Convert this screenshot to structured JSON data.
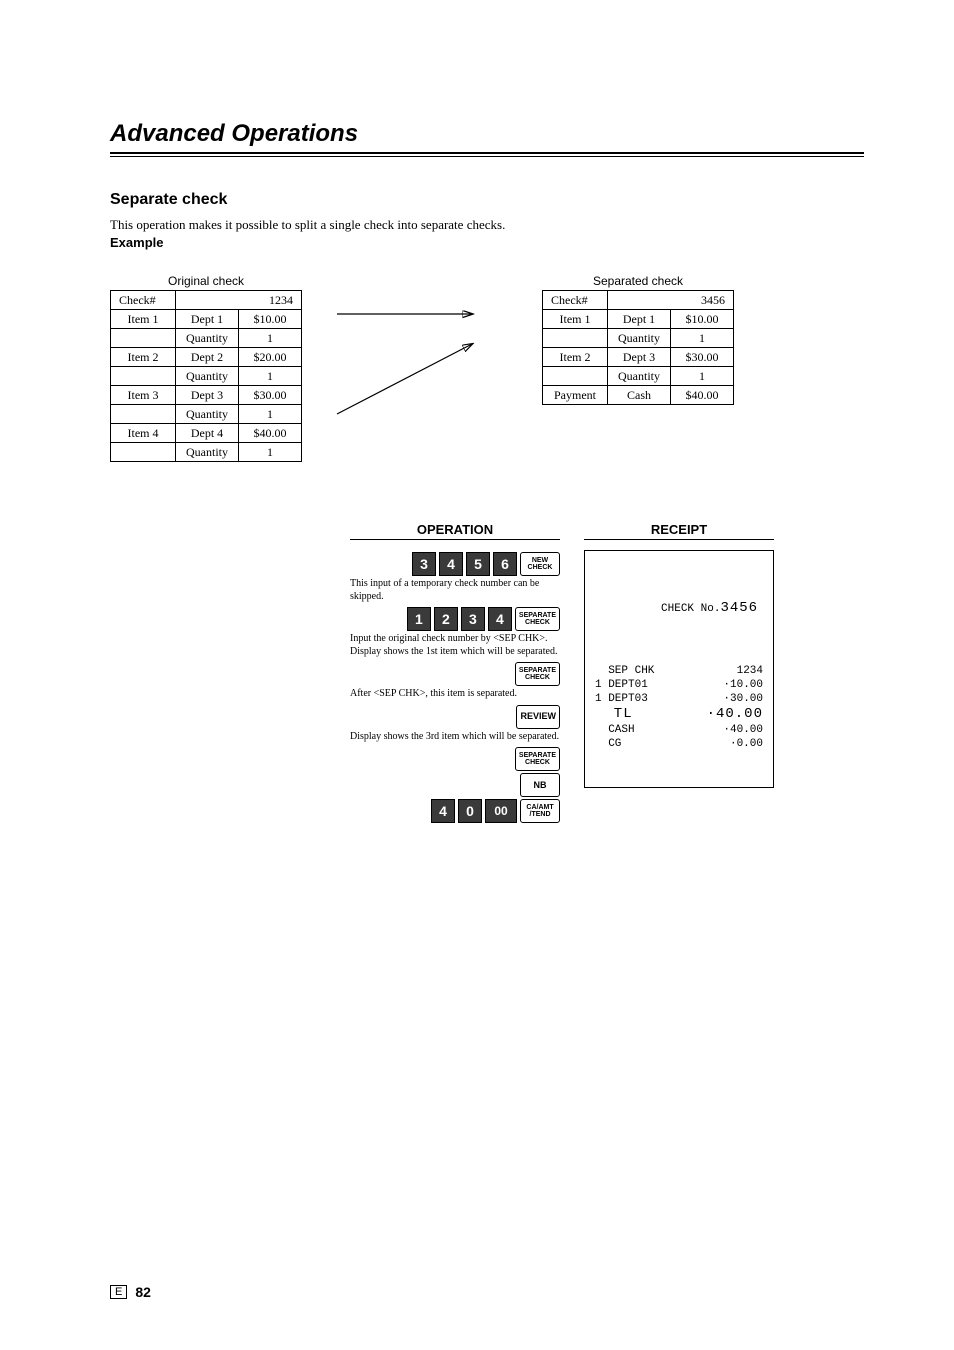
{
  "chapter": {
    "title": "Advanced Operations"
  },
  "section": {
    "title": "Separate check",
    "intro": "This operation makes it possible to split a single check into separate checks.",
    "example_label": "Example"
  },
  "original_check": {
    "caption": "Original check",
    "check_label": "Check#",
    "check_number": "1234",
    "items": [
      {
        "item_label": "Item 1",
        "dept": "Dept 1",
        "price": "$10.00",
        "qty_label": "Quantity",
        "qty": "1"
      },
      {
        "item_label": "Item 2",
        "dept": "Dept 2",
        "price": "$20.00",
        "qty_label": "Quantity",
        "qty": "1"
      },
      {
        "item_label": "Item 3",
        "dept": "Dept 3",
        "price": "$30.00",
        "qty_label": "Quantity",
        "qty": "1"
      },
      {
        "item_label": "Item 4",
        "dept": "Dept 4",
        "price": "$40.00",
        "qty_label": "Quantity",
        "qty": "1"
      }
    ]
  },
  "separated_check": {
    "caption": "Separated check",
    "check_label": "Check#",
    "check_number": "3456",
    "items": [
      {
        "item_label": "Item 1",
        "dept": "Dept 1",
        "price": "$10.00",
        "qty_label": "Quantity",
        "qty": "1"
      },
      {
        "item_label": "Item 2",
        "dept": "Dept 3",
        "price": "$30.00",
        "qty_label": "Quantity",
        "qty": "1"
      }
    ],
    "payment_label": "Payment",
    "payment_method": "Cash",
    "payment_amount": "$40.00"
  },
  "operation": {
    "header": "OPERATION",
    "steps": [
      {
        "keys": [
          "3",
          "4",
          "5",
          "6"
        ],
        "func": "NEW\nCHECK",
        "note": "This input of a temporary check number can be skipped."
      },
      {
        "keys": [
          "1",
          "2",
          "3",
          "4"
        ],
        "func": "SEPARATE\nCHECK",
        "note": "Input the original check number by <SEP CHK>.\nDisplay shows the 1st item which will be separated."
      },
      {
        "keys": [],
        "func": "SEPARATE\nCHECK",
        "note": "After <SEP CHK>, this item is separated."
      },
      {
        "keys": [],
        "func": "REVIEW",
        "note": "Display shows the 3rd item which will be separated."
      },
      {
        "keys": [],
        "func": "SEPARATE\nCHECK",
        "note": ""
      },
      {
        "keys": [],
        "func": "NB",
        "note": ""
      },
      {
        "keys": [
          "4",
          "0",
          "00"
        ],
        "func": "CA/AMT\n/TEND",
        "note": ""
      }
    ]
  },
  "receipt": {
    "header": "RECEIPT",
    "title_prefix": "CHECK No.",
    "title_number": "3456",
    "lines": [
      {
        "l": "  SEP CHK",
        "r": "1234"
      },
      {
        "l": "1 DEPT01",
        "r": "·10.00"
      },
      {
        "l": "1 DEPT03",
        "r": "·30.00"
      },
      {
        "l": "  TL",
        "r": "·40.00",
        "big": true
      },
      {
        "l": "  CASH",
        "r": "·40.00"
      },
      {
        "l": "  CG",
        "r": "·0.00"
      }
    ]
  },
  "footer": {
    "lang": "E",
    "page": "82"
  }
}
